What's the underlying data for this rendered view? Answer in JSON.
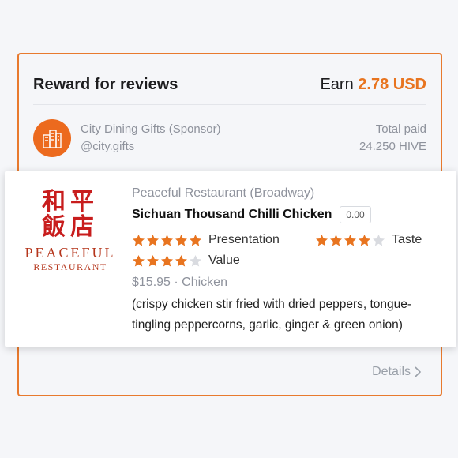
{
  "reward": {
    "title": "Reward for reviews",
    "earn_label": "Earn",
    "earn_amount": "2.78 USD",
    "accent_color": "#e8741f"
  },
  "sponsor": {
    "name": "City Dining Gifts (Sponsor)",
    "handle": "@city.gifts",
    "paid_label": "Total paid",
    "paid_value": "24.250 HIVE",
    "avatar_icon": "building-icon"
  },
  "dish": {
    "restaurant": "Peaceful Restaurant (Broadway)",
    "name": "Sichuan Thousand Chilli Chicken",
    "score": "0.00",
    "logo": {
      "chars_top": "和平",
      "chars_bottom": "飯店",
      "line1": "PEACEFUL",
      "line2": "RESTAURANT"
    },
    "ratings": [
      {
        "label": "Presentation",
        "stars": 5
      },
      {
        "label": "Value",
        "stars": 4
      },
      {
        "label": "Taste",
        "stars": 4
      }
    ],
    "price": "$15.95",
    "category": "Chicken",
    "description": "(crispy chicken stir fried with dried peppers, tongue-tingling peppercorns, garlic, ginger & green onion)"
  },
  "details_label": "Details"
}
